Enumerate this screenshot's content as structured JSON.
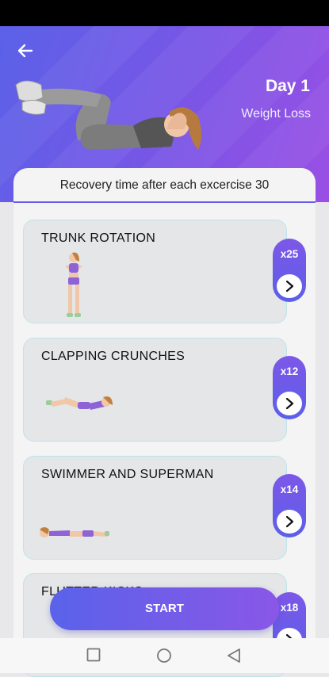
{
  "header": {
    "day_title": "Day 1",
    "subtitle": "Weight Loss",
    "gradient_colors": [
      "#5b61e8",
      "#9a4fe4"
    ]
  },
  "recovery_text": "Recovery time after each excercise 30",
  "exercises": [
    {
      "name": "TRUNK ROTATION",
      "reps": "x25"
    },
    {
      "name": "CLAPPING CRUNCHES",
      "reps": "x12"
    },
    {
      "name": "SWIMMER AND SUPERMAN",
      "reps": "x14"
    },
    {
      "name": "FLUTTER KICKS",
      "reps": "x18"
    }
  ],
  "start_label": "START",
  "icons": {
    "back": "arrow-left-icon",
    "next": "chevron-right-icon",
    "nav_recent": "square-icon",
    "nav_home": "circle-icon",
    "nav_back": "triangle-icon"
  },
  "accent_color": "#6a5ce6"
}
